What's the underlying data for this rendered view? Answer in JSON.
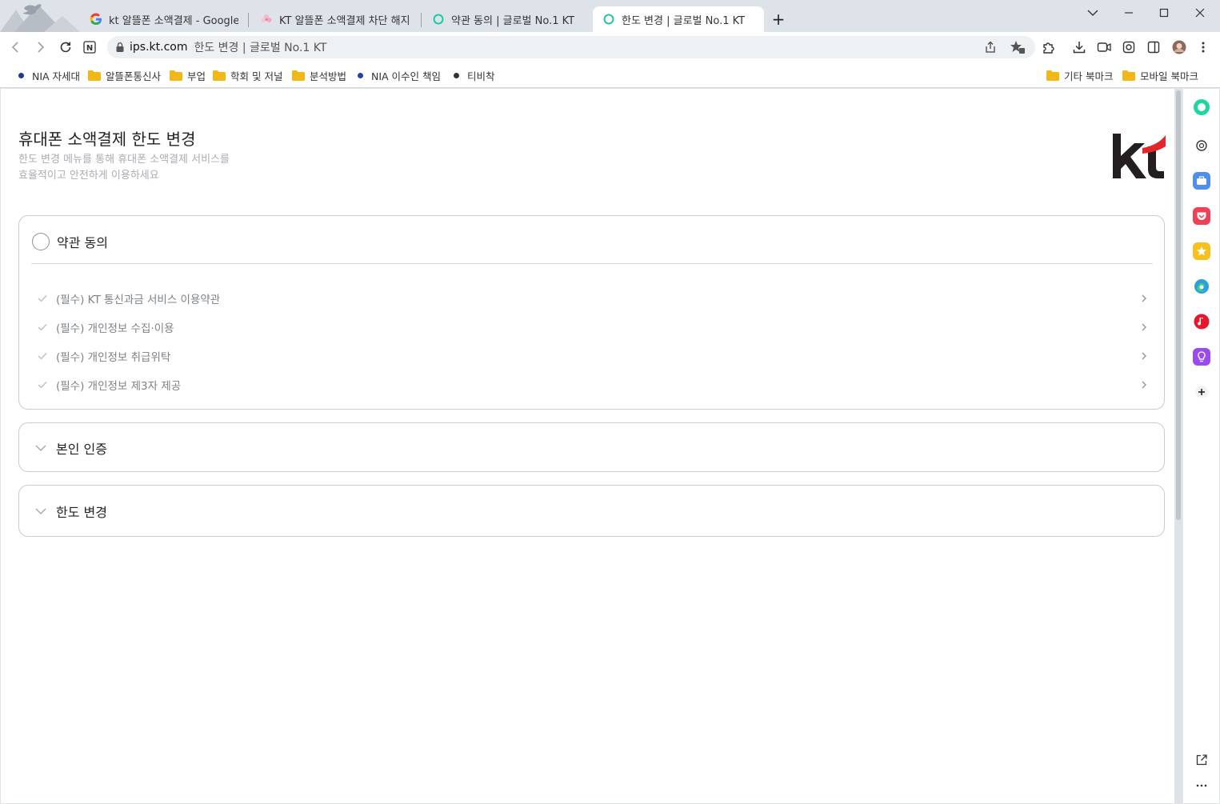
{
  "browser": {
    "tabs": [
      {
        "label": "kt 알뜰폰 소액결제 - Google 검",
        "icon": "google-icon",
        "active": false
      },
      {
        "label": "KT 알뜰폰 소액결제 차단 해지 등",
        "icon": "blossom-icon",
        "active": false
      },
      {
        "label": "약관 동의 | 글로벌 No.1 KT",
        "icon": "ring-icon",
        "active": false
      },
      {
        "label": "한도 변경 | 글로벌 No.1 KT",
        "icon": "ring-icon",
        "active": true
      }
    ],
    "new_tab": "+",
    "address": {
      "host": "ips.kt.com",
      "title": "한도 변경 | 글로벌 No.1 KT"
    },
    "bookmarks": [
      {
        "label": "NIA 자세대",
        "icon": "dot",
        "color": "#1f3a93"
      },
      {
        "label": "알뜰폰통신사",
        "icon": "folder"
      },
      {
        "label": "부업",
        "icon": "folder"
      },
      {
        "label": "학회 및 저널",
        "icon": "folder"
      },
      {
        "label": "분석방법",
        "icon": "folder"
      },
      {
        "label": "NIA 이수인 책임",
        "icon": "dot",
        "color": "#2a3f9e"
      },
      {
        "label": "티비착",
        "icon": "dot",
        "color": "#333333"
      }
    ],
    "bookmarks_right": [
      {
        "label": "기타 북마크",
        "icon": "folder"
      },
      {
        "label": "모바일 북마크",
        "icon": "folder"
      }
    ]
  },
  "page": {
    "title": "휴대폰 소액결제 한도 변경",
    "desc_line1": "한도 변경 메뉴를 통해 휴대폰 소액결제 서비스를",
    "desc_line2": "효율적이고 안전하게 이용하세요",
    "logo": "kt",
    "sections": {
      "agree": {
        "title": "약관 동의",
        "terms": [
          "(필수) KT 통신과금 서비스 이용약관",
          "(필수) 개인정보 수집·이용",
          "(필수) 개인정보 취급위탁",
          "(필수) 개인정보 제3자 제공"
        ]
      },
      "auth": {
        "title": "본인 인증"
      },
      "limit": {
        "title": "한도 변경"
      }
    }
  },
  "colors": {
    "kt_black": "#231f20",
    "kt_red": "#e4252a",
    "border": "#c9ccd0",
    "muted_text": "#7d8287"
  }
}
